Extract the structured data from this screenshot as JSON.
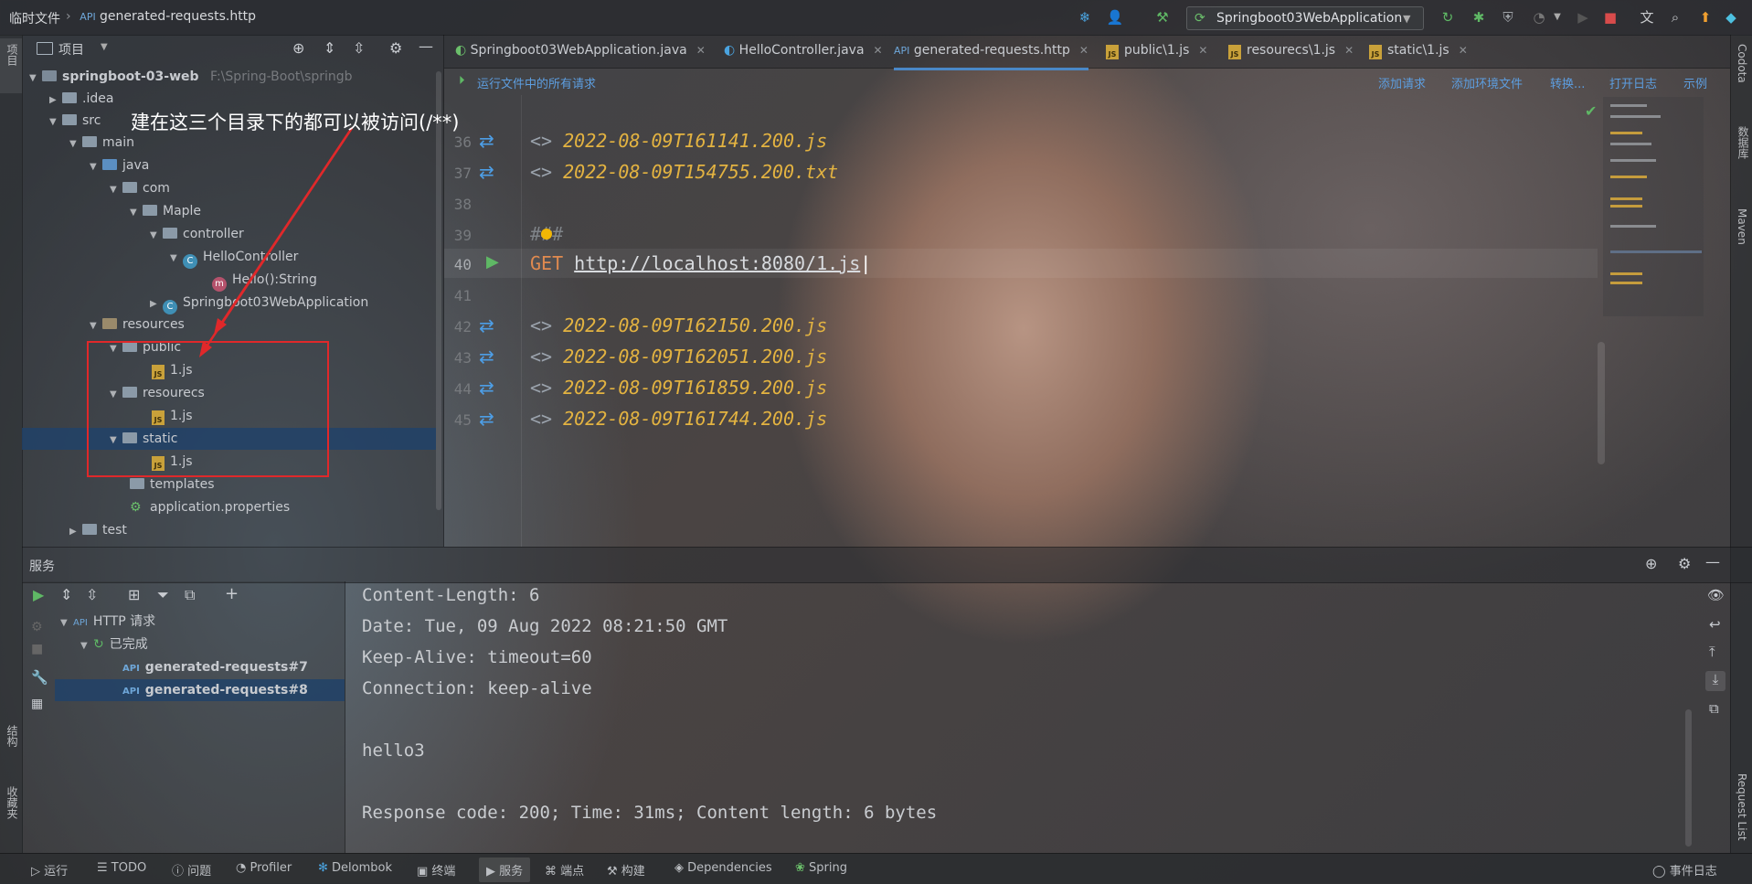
{
  "titlebar": {
    "breadcrumb_root": "临时文件",
    "breadcrumb_file": "generated-requests.http",
    "run_config": "Springboot03WebApplication"
  },
  "left_tool_window": {
    "project_label": "项目"
  },
  "project_panel": {
    "title": "项目",
    "tree": [
      {
        "label": "springboot-03-web",
        "hint": "F:\\Spring-Boot\\springb"
      },
      {
        "label": ".idea"
      },
      {
        "label": "src"
      },
      {
        "label": "main"
      },
      {
        "label": "java"
      },
      {
        "label": "com"
      },
      {
        "label": "Maple"
      },
      {
        "label": "controller"
      },
      {
        "label": "HelloController"
      },
      {
        "label": "Hello():String"
      },
      {
        "label": "Springboot03WebApplication"
      },
      {
        "label": "resources"
      },
      {
        "label": "public"
      },
      {
        "label": "1.js"
      },
      {
        "label": "resourecs"
      },
      {
        "label": "1.js"
      },
      {
        "label": "static"
      },
      {
        "label": "1.js"
      },
      {
        "label": "templates"
      },
      {
        "label": "application.properties"
      },
      {
        "label": "test"
      }
    ]
  },
  "annotation": {
    "text": "建在这三个目录下的都可以被访问(/**)"
  },
  "editor": {
    "tabs": [
      {
        "label": "Springboot03WebApplication.java"
      },
      {
        "label": "HelloController.java"
      },
      {
        "label": "generated-requests.http"
      },
      {
        "label": "public\\1.js"
      },
      {
        "label": "resourecs\\1.js"
      },
      {
        "label": "static\\1.js"
      }
    ],
    "http_toolbar": {
      "run_all": "运行文件中的所有请求",
      "add_request": "添加请求",
      "add_env": "添加环境文件",
      "convert": "转换...",
      "open_log": "打开日志",
      "examples": "示例"
    },
    "lines": [
      {
        "num": "36",
        "text": "2022-08-09T161141.200.js"
      },
      {
        "num": "37",
        "text": "2022-08-09T154755.200.txt"
      },
      {
        "num": "38",
        "text": ""
      },
      {
        "num": "39",
        "text": "###"
      },
      {
        "num": "40",
        "method": "GET",
        "url": "http://localhost:8080/1.js"
      },
      {
        "num": "41",
        "text": ""
      },
      {
        "num": "42",
        "text": "2022-08-09T162150.200.js"
      },
      {
        "num": "43",
        "text": "2022-08-09T162051.200.js"
      },
      {
        "num": "44",
        "text": "2022-08-09T161859.200.js"
      },
      {
        "num": "45",
        "text": "2022-08-09T161744.200.js"
      }
    ],
    "response_prefix": "<>"
  },
  "right_tool_window": {
    "codota": "Codota",
    "database": "数据库",
    "maven": "Maven",
    "request_list": "Request List"
  },
  "services": {
    "title": "服务",
    "tree": [
      {
        "label": "HTTP 请求"
      },
      {
        "label": "已完成"
      },
      {
        "label": "generated-requests#7"
      },
      {
        "label": "generated-requests#8"
      }
    ],
    "output": [
      "Content-Length: 6",
      "Date: Tue, 09 Aug 2022 08:21:50 GMT",
      "Keep-Alive: timeout=60",
      "Connection: keep-alive",
      "",
      "hello3",
      "",
      "Response code: 200; Time: 31ms; Content length: 6 bytes"
    ]
  },
  "left_side_labels": {
    "structure": "结构",
    "bookmarks": "收藏夹"
  },
  "statusbar": {
    "items": [
      {
        "label": "运行"
      },
      {
        "label": "TODO"
      },
      {
        "label": "问题"
      },
      {
        "label": "Profiler"
      },
      {
        "label": "Delombok"
      },
      {
        "label": "终端"
      },
      {
        "label": "服务"
      },
      {
        "label": "端点"
      },
      {
        "label": "构建"
      },
      {
        "label": "Dependencies"
      },
      {
        "label": "Spring"
      }
    ],
    "event_log": "事件日志"
  }
}
